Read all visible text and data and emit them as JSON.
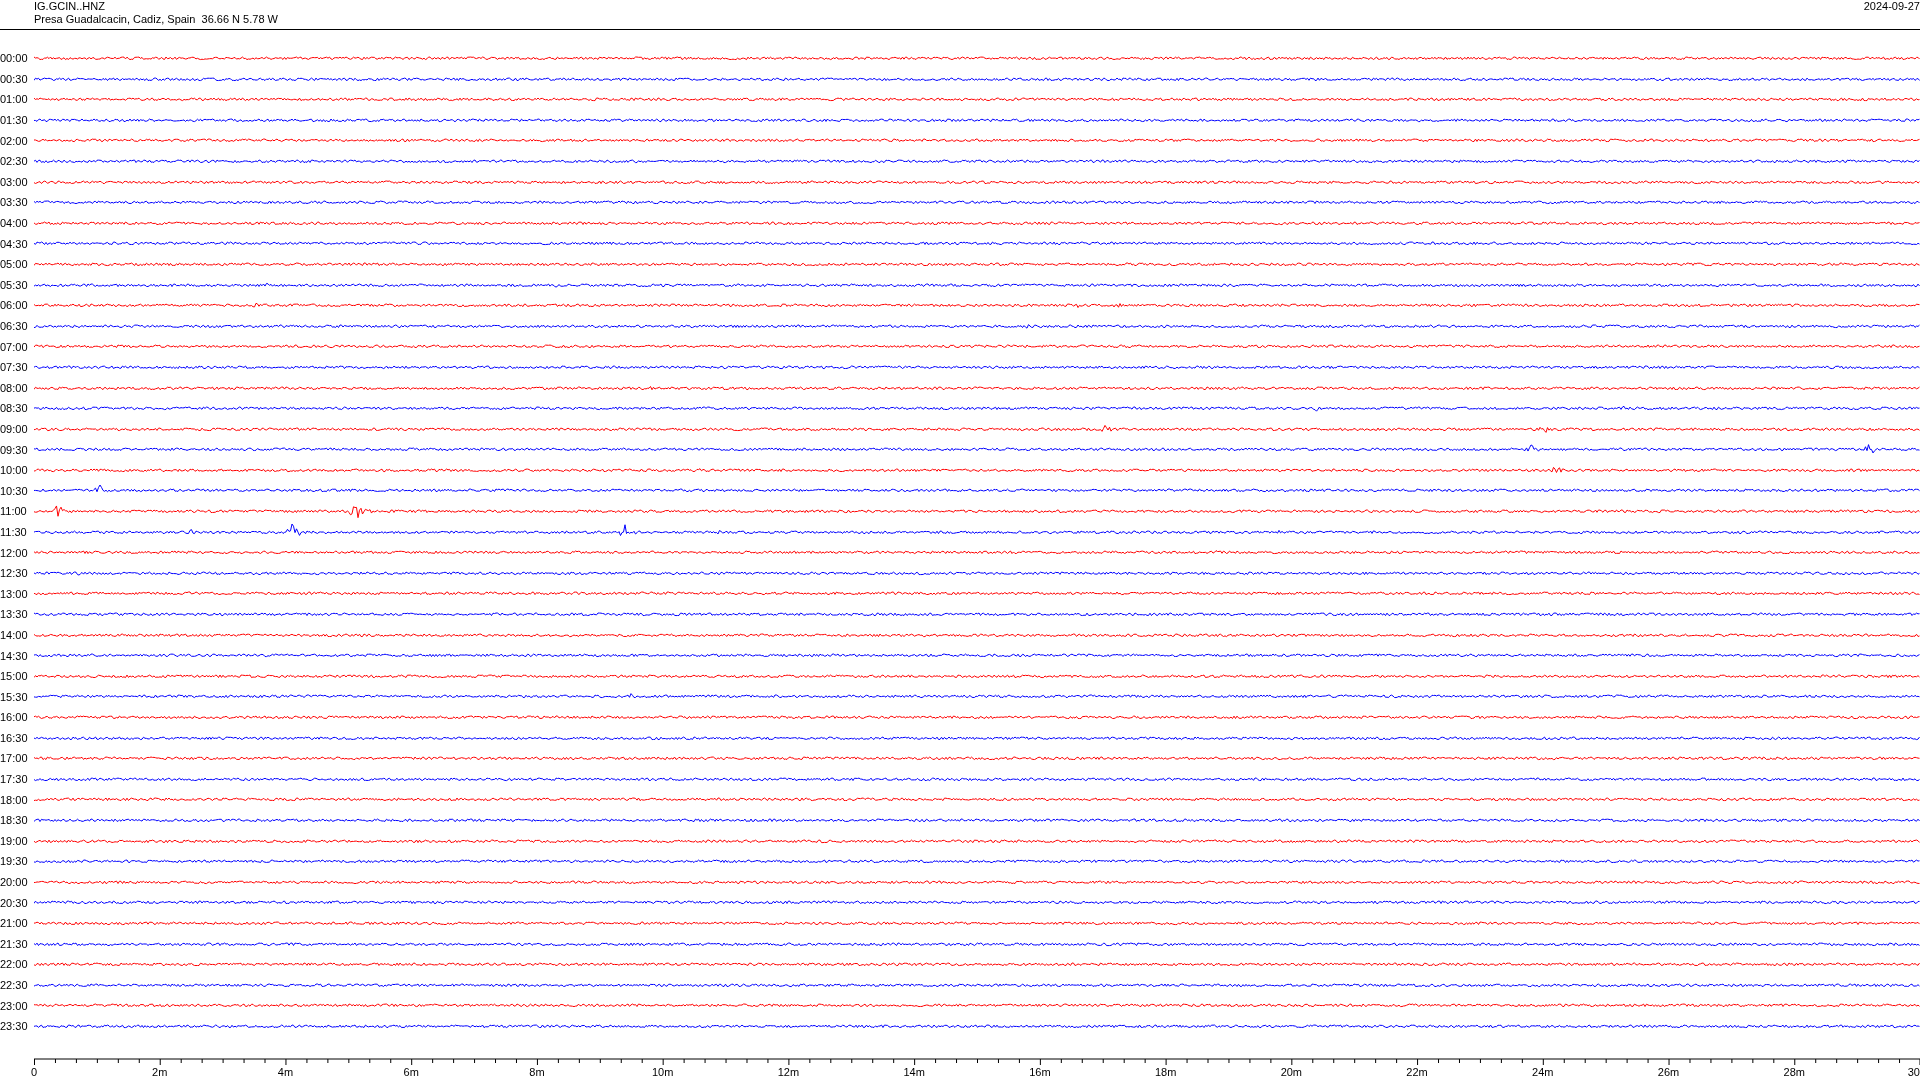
{
  "header": {
    "station": "IG.GCIN..HNZ",
    "location": "Presa Guadalcacin, Cadiz, Spain  36.66 N 5.78 W",
    "date": "2024-09-27"
  },
  "traces": [
    {
      "time": "00:00",
      "color": "#ff0000"
    },
    {
      "time": "00:30",
      "color": "#0000ff"
    },
    {
      "time": "01:00",
      "color": "#ff0000"
    },
    {
      "time": "01:30",
      "color": "#0000ff"
    },
    {
      "time": "02:00",
      "color": "#ff0000"
    },
    {
      "time": "02:30",
      "color": "#0000ff"
    },
    {
      "time": "03:00",
      "color": "#ff0000"
    },
    {
      "time": "03:30",
      "color": "#0000ff"
    },
    {
      "time": "04:00",
      "color": "#ff0000"
    },
    {
      "time": "04:30",
      "color": "#0000ff"
    },
    {
      "time": "05:00",
      "color": "#ff0000"
    },
    {
      "time": "05:30",
      "color": "#0000ff"
    },
    {
      "time": "06:00",
      "color": "#ff0000"
    },
    {
      "time": "06:30",
      "color": "#0000ff"
    },
    {
      "time": "07:00",
      "color": "#ff0000"
    },
    {
      "time": "07:30",
      "color": "#0000ff"
    },
    {
      "time": "08:00",
      "color": "#ff0000"
    },
    {
      "time": "08:30",
      "color": "#0000ff"
    },
    {
      "time": "09:00",
      "color": "#ff0000"
    },
    {
      "time": "09:30",
      "color": "#0000ff"
    },
    {
      "time": "10:00",
      "color": "#ff0000"
    },
    {
      "time": "10:30",
      "color": "#0000ff"
    },
    {
      "time": "11:00",
      "color": "#ff0000"
    },
    {
      "time": "11:30",
      "color": "#0000ff"
    },
    {
      "time": "12:00",
      "color": "#ff0000"
    },
    {
      "time": "12:30",
      "color": "#0000ff"
    },
    {
      "time": "13:00",
      "color": "#ff0000"
    },
    {
      "time": "13:30",
      "color": "#0000ff"
    },
    {
      "time": "14:00",
      "color": "#ff0000"
    },
    {
      "time": "14:30",
      "color": "#0000ff"
    },
    {
      "time": "15:00",
      "color": "#ff0000"
    },
    {
      "time": "15:30",
      "color": "#0000ff"
    },
    {
      "time": "16:00",
      "color": "#ff0000"
    },
    {
      "time": "16:30",
      "color": "#0000ff"
    },
    {
      "time": "17:00",
      "color": "#ff0000"
    },
    {
      "time": "17:30",
      "color": "#0000ff"
    },
    {
      "time": "18:00",
      "color": "#ff0000"
    },
    {
      "time": "18:30",
      "color": "#0000ff"
    },
    {
      "time": "19:00",
      "color": "#ff0000"
    },
    {
      "time": "19:30",
      "color": "#0000ff"
    },
    {
      "time": "20:00",
      "color": "#ff0000"
    },
    {
      "time": "20:30",
      "color": "#0000ff"
    },
    {
      "time": "21:00",
      "color": "#ff0000"
    },
    {
      "time": "21:30",
      "color": "#0000ff"
    },
    {
      "time": "22:00",
      "color": "#ff0000"
    },
    {
      "time": "22:30",
      "color": "#0000ff"
    },
    {
      "time": "23:00",
      "color": "#ff0000"
    },
    {
      "time": "23:30",
      "color": "#0000ff"
    }
  ],
  "axis": {
    "labels": [
      "0",
      "2m",
      "4m",
      "6m",
      "8m",
      "10m",
      "12m",
      "14m",
      "16m",
      "18m",
      "20m",
      "22m",
      "24m",
      "26m",
      "28m",
      "30"
    ]
  }
}
